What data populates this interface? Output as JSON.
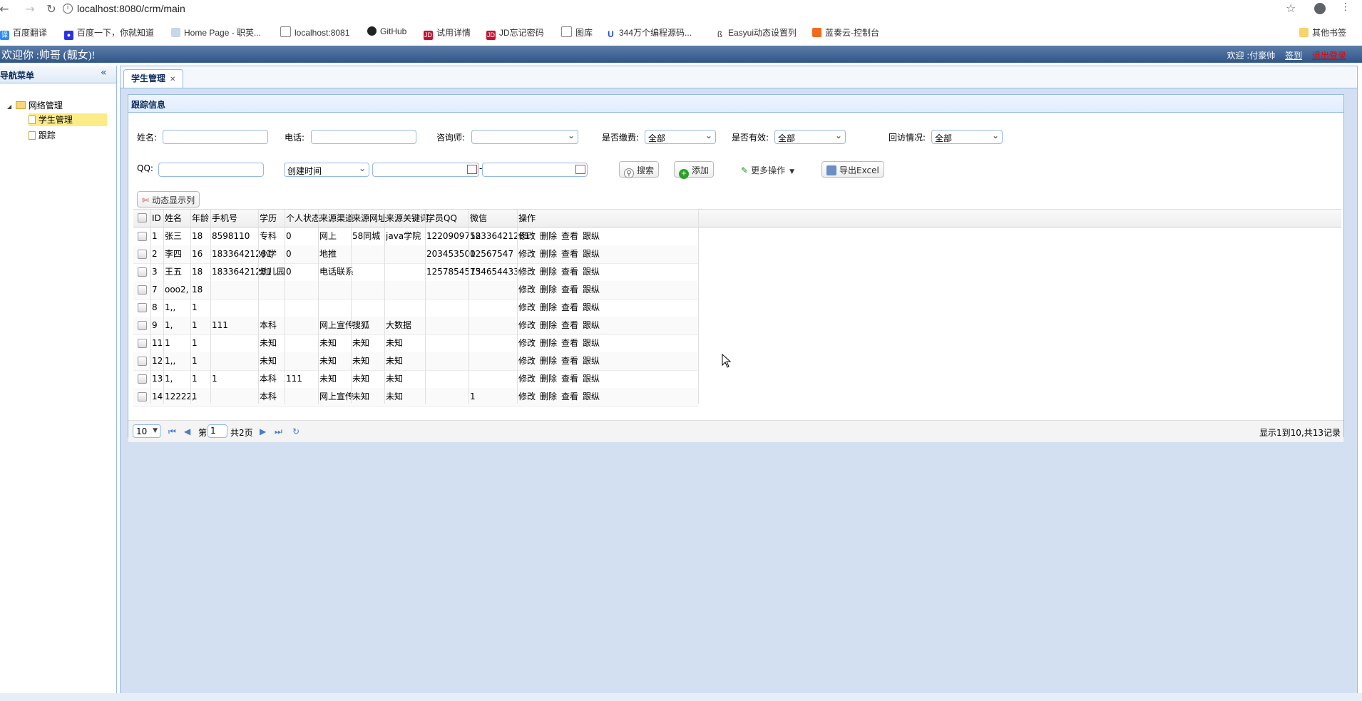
{
  "browser": {
    "url": "localhost:8080/crm/main",
    "bookmarks": [
      {
        "label": "百度翻译",
        "icon": "translate-icon"
      },
      {
        "label": "百度一下，你就知道",
        "icon": "baidu-paw-icon"
      },
      {
        "label": "Home Page - 职英...",
        "icon": "page-icon"
      },
      {
        "label": "localhost:8081",
        "icon": "document-icon"
      },
      {
        "label": "GitHub",
        "icon": "github-icon"
      },
      {
        "label": "试用详情",
        "icon": "jd-icon"
      },
      {
        "label": "JD忘记密码",
        "icon": "jd-icon"
      },
      {
        "label": "图库",
        "icon": "document-icon"
      },
      {
        "label": "344万个编程源码...",
        "icon": "u-icon"
      },
      {
        "label": "Easyui动态设置列",
        "icon": "easyui-icon"
      },
      {
        "label": "蓝奏云-控制台",
        "icon": "flag-icon"
      },
      {
        "label": "其他书签",
        "icon": "folder-icon"
      }
    ]
  },
  "header": {
    "title": "欢迎你 :帅哥 (靓女)!",
    "user": "欢迎 :付豪帅",
    "sign_in": "签到",
    "logout": "退出登录"
  },
  "nav": {
    "title": "导航菜单",
    "group": "网络管理",
    "items": [
      "学生管理",
      "跟踪"
    ]
  },
  "tabs": [
    {
      "label": "学生管理"
    }
  ],
  "panel": {
    "title": "跟踪信息",
    "filters": {
      "name_label": "姓名:",
      "phone_label": "电话:",
      "consultant_label": "咨询师:",
      "paid_label": "是否缴费:",
      "paid_value": "全部",
      "valid_label": "是否有效:",
      "valid_value": "全部",
      "visit_label": "回访情况:",
      "visit_value": "全部",
      "qq_label": "QQ:",
      "date_field": "创建时间",
      "date_sep": "-"
    },
    "buttons": {
      "search": "搜索",
      "add": "添加",
      "more": "更多操作",
      "export": "导出Excel",
      "dynamic_cols": "动态显示列"
    }
  },
  "grid": {
    "columns": [
      "ID",
      "姓名",
      "年龄",
      "手机号",
      "学历",
      "个人状态",
      "来源渠道",
      "来源网址",
      "来源关键词",
      "学员QQ",
      "微信",
      "操作"
    ],
    "ops": [
      "修改",
      "删除",
      "查看",
      "跟纵"
    ],
    "rows": [
      [
        "1",
        "张三",
        "18",
        "8598110",
        "专科",
        "0",
        "网上",
        "58同城",
        "java学院",
        "1220909752",
        "18336421281"
      ],
      [
        "2",
        "李四",
        "16",
        "18336421281",
        "小学",
        "0",
        "地推",
        "",
        "",
        "203453500",
        "12567547"
      ],
      [
        "3",
        "王五",
        "18",
        "18336421281",
        "幼儿园",
        "0",
        "电话联系",
        "",
        "",
        "1257854575",
        "134654433"
      ],
      [
        "7",
        "ooo2,",
        "18",
        "",
        "",
        "",
        "",
        "",
        "",
        "",
        ""
      ],
      [
        "8",
        "1,,",
        "1",
        "",
        "",
        "",
        "",
        "",
        "",
        "",
        ""
      ],
      [
        "9",
        "1,",
        "1",
        "111",
        "本科",
        "",
        "网上宣传",
        "搜狐",
        "大数据",
        "",
        ""
      ],
      [
        "11",
        "1",
        "1",
        "",
        "未知",
        "",
        "未知",
        "未知",
        "未知",
        "",
        ""
      ],
      [
        "12",
        "1,,",
        "1",
        "",
        "未知",
        "",
        "未知",
        "未知",
        "未知",
        "",
        ""
      ],
      [
        "13",
        "1,",
        "1",
        "1",
        "本科",
        "111",
        "未知",
        "未知",
        "未知",
        "",
        ""
      ],
      [
        "14",
        "12222,",
        "1",
        "",
        "本科",
        "",
        "网上宣传",
        "未知",
        "未知",
        "",
        "1"
      ]
    ]
  },
  "pager": {
    "page_size": "10",
    "page_prefix": "第",
    "page_value": "1",
    "page_total": "共2页",
    "summary": "显示1到10,共13记录"
  }
}
